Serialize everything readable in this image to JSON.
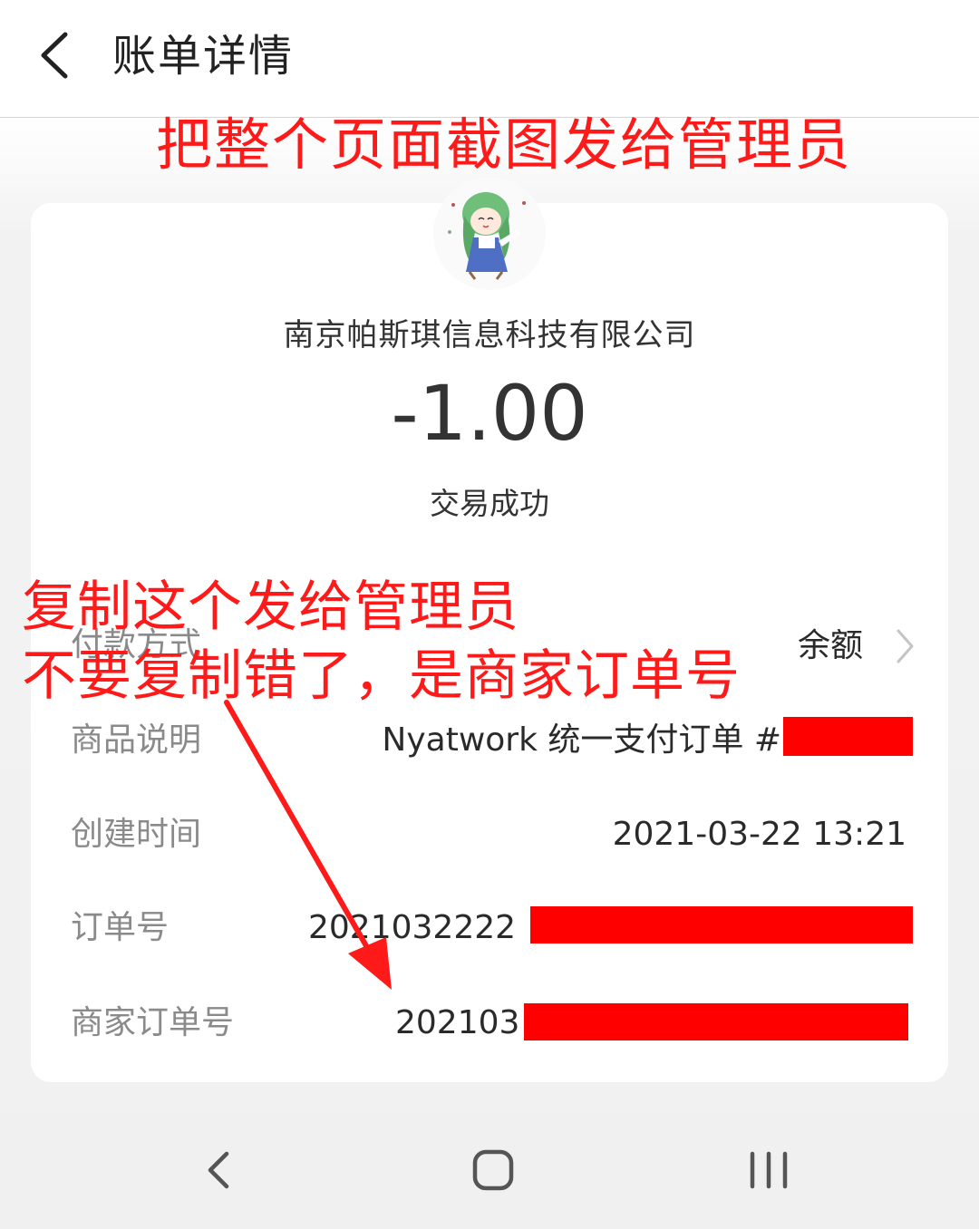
{
  "header": {
    "title": "账单详情",
    "back_icon": "chevron-left-icon"
  },
  "annotations": {
    "top": "把整个页面截图发给管理员",
    "middle_line1": "复制这个发给管理员",
    "middle_line2": "不要复制错了，是商家订单号",
    "color": "#ff1a1a"
  },
  "summary": {
    "merchant": "南京帕斯琪信息科技有限公司",
    "amount": "-1.00",
    "status": "交易成功"
  },
  "details": {
    "payment_method": {
      "label": "付款方式",
      "value": "余额"
    },
    "product_desc": {
      "label": "商品说明",
      "value": "Nyatwork 统一支付订单 #"
    },
    "created_time": {
      "label": "创建时间",
      "value": "2021-03-22 13:21"
    },
    "order_no": {
      "label": "订单号",
      "value": "2021032222"
    },
    "merchant_order_no": {
      "label": "商家订单号",
      "value": "202103"
    }
  },
  "colors": {
    "redaction": "#ff0000",
    "annotation": "#ff1a1a",
    "text_primary": "#333333",
    "text_label": "#8a8a8a"
  },
  "navbar": {
    "back_icon": "nav-back-icon",
    "home_icon": "nav-home-icon",
    "recents_icon": "nav-recents-icon"
  }
}
